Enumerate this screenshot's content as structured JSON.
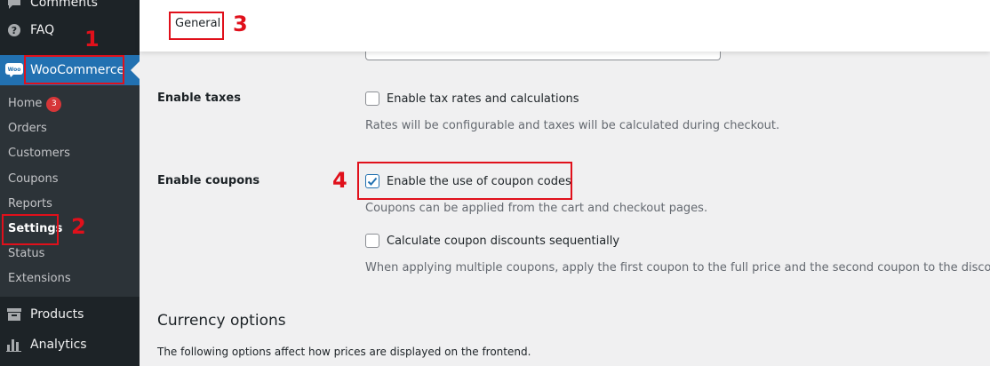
{
  "sidebar": {
    "comments_label": "Comments",
    "faq_label": "FAQ",
    "woocommerce_label": "WooCommerce",
    "woo_icon_text": "Woo",
    "submenu": [
      {
        "label": "Home",
        "badge": "3"
      },
      {
        "label": "Orders"
      },
      {
        "label": "Customers"
      },
      {
        "label": "Coupons"
      },
      {
        "label": "Reports"
      },
      {
        "label": "Settings"
      },
      {
        "label": "Status"
      },
      {
        "label": "Extensions"
      }
    ],
    "products_label": "Products",
    "analytics_label": "Analytics"
  },
  "header": {
    "tab_general": "General"
  },
  "settings": {
    "enable_taxes": {
      "label": "Enable taxes",
      "checkbox_label": "Enable tax rates and calculations",
      "checked": false,
      "description": "Rates will be configurable and taxes will be calculated during checkout."
    },
    "enable_coupons": {
      "label": "Enable coupons",
      "checkbox_label": "Enable the use of coupon codes",
      "checked": true,
      "description": "Coupons can be applied from the cart and checkout pages.",
      "sequential_label": "Calculate coupon discounts sequentially",
      "sequential_checked": false,
      "sequential_description": "When applying multiple coupons, apply the first coupon to the full price and the second coupon to the discounted"
    },
    "currency": {
      "heading": "Currency options",
      "description": "The following options affect how prices are displayed on the frontend."
    }
  },
  "annotations": {
    "n1": "1",
    "n2": "2",
    "n3": "3",
    "n4": "4"
  },
  "colors": {
    "sidebar_bg": "#1d2327",
    "submenu_bg": "#2c3338",
    "accent": "#2271b1",
    "annotation": "#e0101b",
    "badge": "#d63638"
  }
}
